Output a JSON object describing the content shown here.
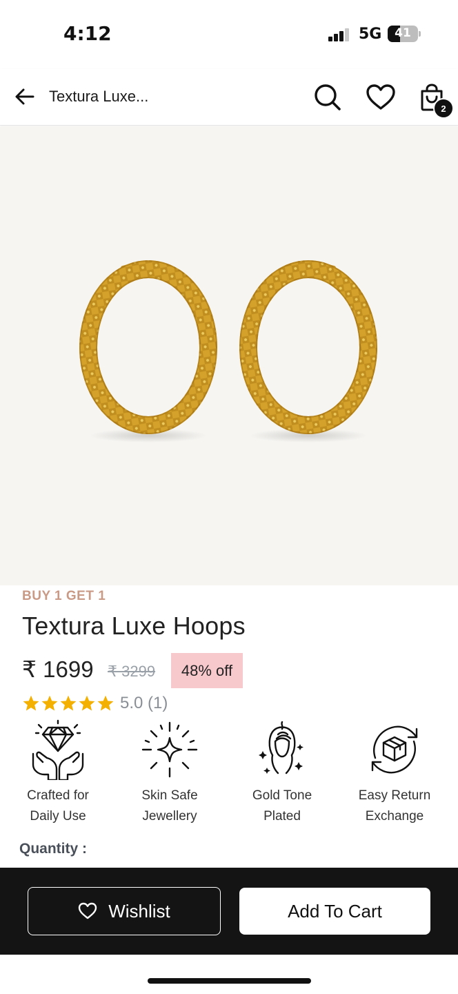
{
  "status_bar": {
    "time": "4:12",
    "network": "5G",
    "battery_percent": "41",
    "battery_level": 0.41,
    "signal_bars": 3
  },
  "header": {
    "title": "Textura Luxe...",
    "icons": [
      "back-arrow-icon",
      "search-icon",
      "heart-icon",
      "shopping-bag-icon"
    ],
    "cart_count": "2"
  },
  "product": {
    "image_subject": "gold-textured-hoop-earrings",
    "promo_label": "BUY 1 GET 1",
    "name": "Textura Luxe Hoops",
    "price": "₹ 1699",
    "mrp": "₹ 3299",
    "discount": "48% off",
    "rating": 5.0,
    "rating_text": "5.0 (1)",
    "star_count": 5
  },
  "features": [
    {
      "label": "Crafted for\nDaily Use",
      "icon": "diamond-hands-icon"
    },
    {
      "label": "Skin Safe\nJewellery",
      "icon": "sparkle-icon"
    },
    {
      "label": "Gold Tone\nPlated",
      "icon": "woman-head-icon"
    },
    {
      "label": "Easy Return\nExchange",
      "icon": "box-return-icon"
    }
  ],
  "quantity_label": "Quantity :",
  "actions": {
    "wishlist_label": "Wishlist",
    "add_to_cart_label": "Add To Cart"
  },
  "colors": {
    "promo": "#c99a86",
    "discount_bg": "#f8c9cc",
    "star": "#f4b000",
    "bottom_bar": "#141414",
    "image_bg": "#f6f5f2",
    "gold": "#d4a22a"
  }
}
